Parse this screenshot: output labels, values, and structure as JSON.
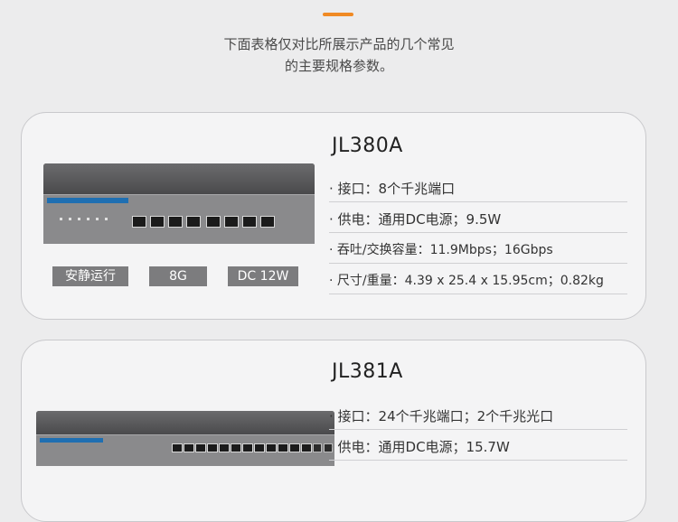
{
  "intro": {
    "line1": "下面表格仅对比所展示产品的几个常见",
    "line2": "的主要规格参数。"
  },
  "products": [
    {
      "model": "JL380A",
      "specs": [
        "· 接口：8个千兆端口",
        "· 供电：通用DC电源；9.5W",
        "· 吞吐/交换容量：11.9Mbps；16Gbps",
        "· 尺寸/重量：4.39 x 25.4 x 15.95cm；0.82kg"
      ],
      "badges": [
        "安静运行",
        "8G",
        "DC 12W"
      ]
    },
    {
      "model": "JL381A",
      "specs": [
        "· 接口：24个千兆端口；2个千兆光口",
        "· 供电：通用DC电源；15.7W"
      ]
    }
  ],
  "colors": {
    "accent": "#f08a24",
    "badge": "#7c7c7e",
    "card_bg": "#f4f4f5"
  },
  "icons": [
    "switch-image-jl380a",
    "switch-image-jl381a"
  ]
}
